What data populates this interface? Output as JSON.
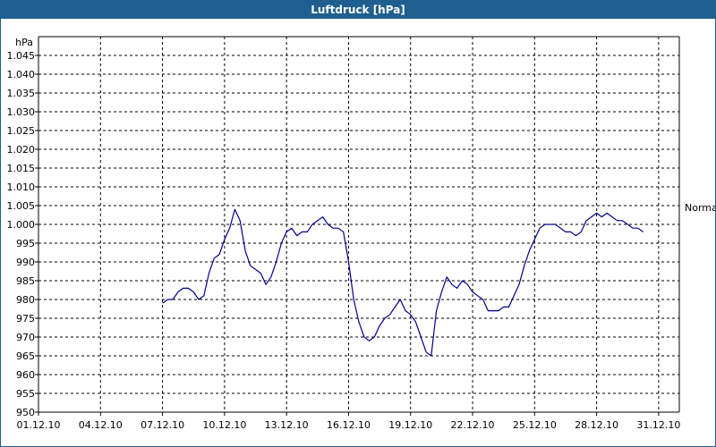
{
  "window": {
    "title": "Luftdruck [hPa]"
  },
  "chart_data": {
    "type": "line",
    "title": "Luftdruck [hPa]",
    "ylabel": "hPa",
    "xlabel": "",
    "ylim": [
      950,
      1050
    ],
    "xlim_day": [
      1,
      32
    ],
    "grid": true,
    "y_ticks": [
      "950",
      "955",
      "960",
      "965",
      "970",
      "975",
      "980",
      "985",
      "990",
      "995",
      "1.000",
      "1.005",
      "1.010",
      "1.015",
      "1.020",
      "1.025",
      "1.030",
      "1.035",
      "1.040",
      "1.045"
    ],
    "x_ticks": [
      "01.12.10",
      "04.12.10",
      "07.12.10",
      "10.12.10",
      "13.12.10",
      "16.12.10",
      "19.12.10",
      "22.12.10",
      "25.12.10",
      "28.12.10",
      "31.12.10"
    ],
    "reference_line": {
      "label": "Normal",
      "value": 1004.5
    },
    "series": [
      {
        "color": "#00008b",
        "points": [
          [
            "2010-12-07 00:00",
            979
          ],
          [
            "2010-12-07 06:00",
            980
          ],
          [
            "2010-12-07 12:00",
            980
          ],
          [
            "2010-12-07 18:00",
            982
          ],
          [
            "2010-12-08 00:00",
            983
          ],
          [
            "2010-12-08 06:00",
            983
          ],
          [
            "2010-12-08 12:00",
            982
          ],
          [
            "2010-12-08 18:00",
            980
          ],
          [
            "2010-12-09 00:00",
            981
          ],
          [
            "2010-12-09 06:00",
            987
          ],
          [
            "2010-12-09 12:00",
            991
          ],
          [
            "2010-12-09 18:00",
            992
          ],
          [
            "2010-12-10 00:00",
            996
          ],
          [
            "2010-12-10 06:00",
            999
          ],
          [
            "2010-12-10 12:00",
            1004
          ],
          [
            "2010-12-10 18:00",
            1001
          ],
          [
            "2010-12-11 00:00",
            993
          ],
          [
            "2010-12-11 06:00",
            989
          ],
          [
            "2010-12-11 12:00",
            988
          ],
          [
            "2010-12-11 18:00",
            987
          ],
          [
            "2010-12-12 00:00",
            984
          ],
          [
            "2010-12-12 06:00",
            986
          ],
          [
            "2010-12-12 12:00",
            990
          ],
          [
            "2010-12-12 18:00",
            995
          ],
          [
            "2010-12-13 00:00",
            998
          ],
          [
            "2010-12-13 06:00",
            999
          ],
          [
            "2010-12-13 12:00",
            997
          ],
          [
            "2010-12-13 18:00",
            998
          ],
          [
            "2010-12-14 00:00",
            998
          ],
          [
            "2010-12-14 06:00",
            1000
          ],
          [
            "2010-12-14 12:00",
            1001
          ],
          [
            "2010-12-14 18:00",
            1002
          ],
          [
            "2010-12-15 00:00",
            1000
          ],
          [
            "2010-12-15 06:00",
            999
          ],
          [
            "2010-12-15 12:00",
            999
          ],
          [
            "2010-12-15 18:00",
            998
          ],
          [
            "2010-12-16 00:00",
            990
          ],
          [
            "2010-12-16 06:00",
            980
          ],
          [
            "2010-12-16 12:00",
            974
          ],
          [
            "2010-12-16 18:00",
            970
          ],
          [
            "2010-12-17 00:00",
            969
          ],
          [
            "2010-12-17 06:00",
            970
          ],
          [
            "2010-12-17 12:00",
            973
          ],
          [
            "2010-12-17 18:00",
            975
          ],
          [
            "2010-12-18 00:00",
            976
          ],
          [
            "2010-12-18 06:00",
            978
          ],
          [
            "2010-12-18 12:00",
            980
          ],
          [
            "2010-12-18 18:00",
            977
          ],
          [
            "2010-12-19 00:00",
            976
          ],
          [
            "2010-12-19 06:00",
            974
          ],
          [
            "2010-12-19 12:00",
            970
          ],
          [
            "2010-12-19 18:00",
            966
          ],
          [
            "2010-12-20 00:00",
            965
          ],
          [
            "2010-12-20 06:00",
            977
          ],
          [
            "2010-12-20 12:00",
            982
          ],
          [
            "2010-12-20 18:00",
            986
          ],
          [
            "2010-12-21 00:00",
            984
          ],
          [
            "2010-12-21 06:00",
            983
          ],
          [
            "2010-12-21 12:00",
            985
          ],
          [
            "2010-12-21 18:00",
            984
          ],
          [
            "2010-12-22 00:00",
            982
          ],
          [
            "2010-12-22 06:00",
            981
          ],
          [
            "2010-12-22 12:00",
            980
          ],
          [
            "2010-12-22 18:00",
            977
          ],
          [
            "2010-12-23 00:00",
            977
          ],
          [
            "2010-12-23 06:00",
            977
          ],
          [
            "2010-12-23 12:00",
            978
          ],
          [
            "2010-12-23 18:00",
            978
          ],
          [
            "2010-12-24 00:00",
            981
          ],
          [
            "2010-12-24 06:00",
            984
          ],
          [
            "2010-12-24 12:00",
            989
          ],
          [
            "2010-12-24 18:00",
            993
          ],
          [
            "2010-12-25 00:00",
            996
          ],
          [
            "2010-12-25 06:00",
            999
          ],
          [
            "2010-12-25 12:00",
            1000
          ],
          [
            "2010-12-25 18:00",
            1000
          ],
          [
            "2010-12-26 00:00",
            1000
          ],
          [
            "2010-12-26 06:00",
            999
          ],
          [
            "2010-12-26 12:00",
            998
          ],
          [
            "2010-12-26 18:00",
            998
          ],
          [
            "2010-12-27 00:00",
            997
          ],
          [
            "2010-12-27 06:00",
            998
          ],
          [
            "2010-12-27 12:00",
            1001
          ],
          [
            "2010-12-27 18:00",
            1002
          ],
          [
            "2010-12-28 00:00",
            1003
          ],
          [
            "2010-12-28 06:00",
            1002
          ],
          [
            "2010-12-28 12:00",
            1003
          ],
          [
            "2010-12-28 18:00",
            1002
          ],
          [
            "2010-12-29 00:00",
            1001
          ],
          [
            "2010-12-29 06:00",
            1001
          ],
          [
            "2010-12-29 12:00",
            1000
          ],
          [
            "2010-12-29 18:00",
            999
          ],
          [
            "2010-12-30 00:00",
            999
          ],
          [
            "2010-12-30 06:00",
            998
          ]
        ]
      }
    ]
  }
}
